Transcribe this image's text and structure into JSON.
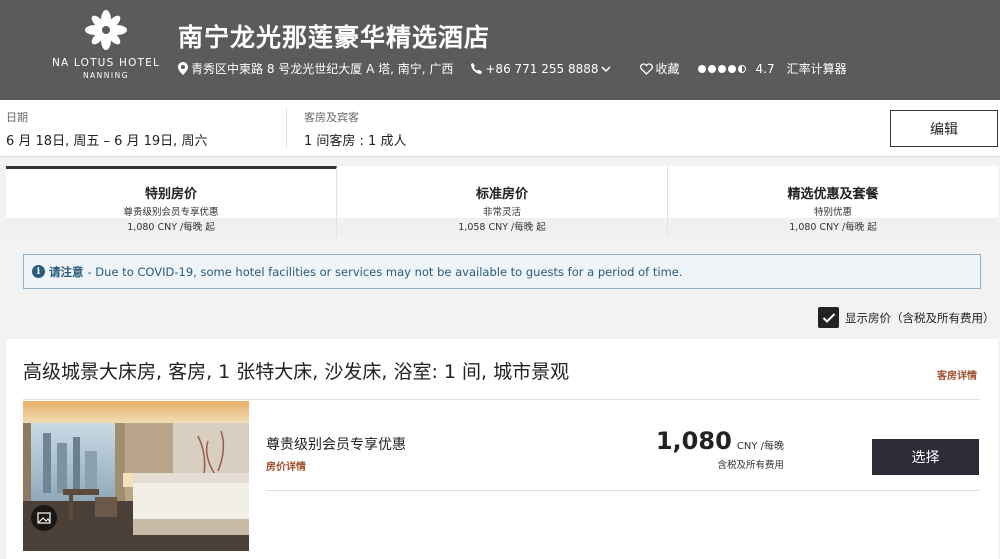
{
  "header": {
    "logo_line1": "NA LOTUS HOTEL",
    "logo_line2": "NANNING",
    "title": "南宁龙光那莲豪华精选酒店",
    "address": "青秀区中柬路 8 号龙光世纪大厦 A 塔, 南宁, 广西",
    "phone": "+86 771 255 8888",
    "favorite": "收藏",
    "rating": "4.7",
    "currency_calculator": "汇率计算器"
  },
  "search": {
    "dates_label": "日期",
    "dates_value": "6 月 18日, 周五 – 6 月 19日, 周六",
    "guests_label": "客房及宾客",
    "guests_value": "1 间客房 : 1 成人",
    "edit_label": "编辑"
  },
  "tabs": [
    {
      "name": "特别房价",
      "sub": "尊贵级别会员专享优惠",
      "price": "1,080 CNY /每晚 起",
      "active": true
    },
    {
      "name": "标准房价",
      "sub": "非常灵活",
      "price": "1,058 CNY /每晚 起",
      "active": false
    },
    {
      "name": "精选优惠及套餐",
      "sub": "特别优惠",
      "price": "1,080 CNY /每晚 起",
      "active": false
    }
  ],
  "notice": {
    "strong": "请注意",
    "text": "- Due to COVID-19, some hotel facilities or services may not be available to guests for a period of time."
  },
  "display": {
    "show_price_label": "显示房价（含税及所有费用）",
    "checked": true
  },
  "room": {
    "title": "高级城景大床房, 客房, 1 张特大床, 沙发床, 浴室: 1 间, 城市景观",
    "details_link": "客房详情",
    "rate_name": "尊贵级别会员专享优惠",
    "rate_details": "房价详情",
    "price": "1,080",
    "price_unit": "CNY /每晚",
    "price_note": "含税及所有费用",
    "select_label": "选择"
  },
  "colors": {
    "header_bg": "#5b5b5b",
    "link_brown": "#a0522d",
    "select_bg": "#2d2d3a",
    "notice_text": "#2a5b7d"
  }
}
